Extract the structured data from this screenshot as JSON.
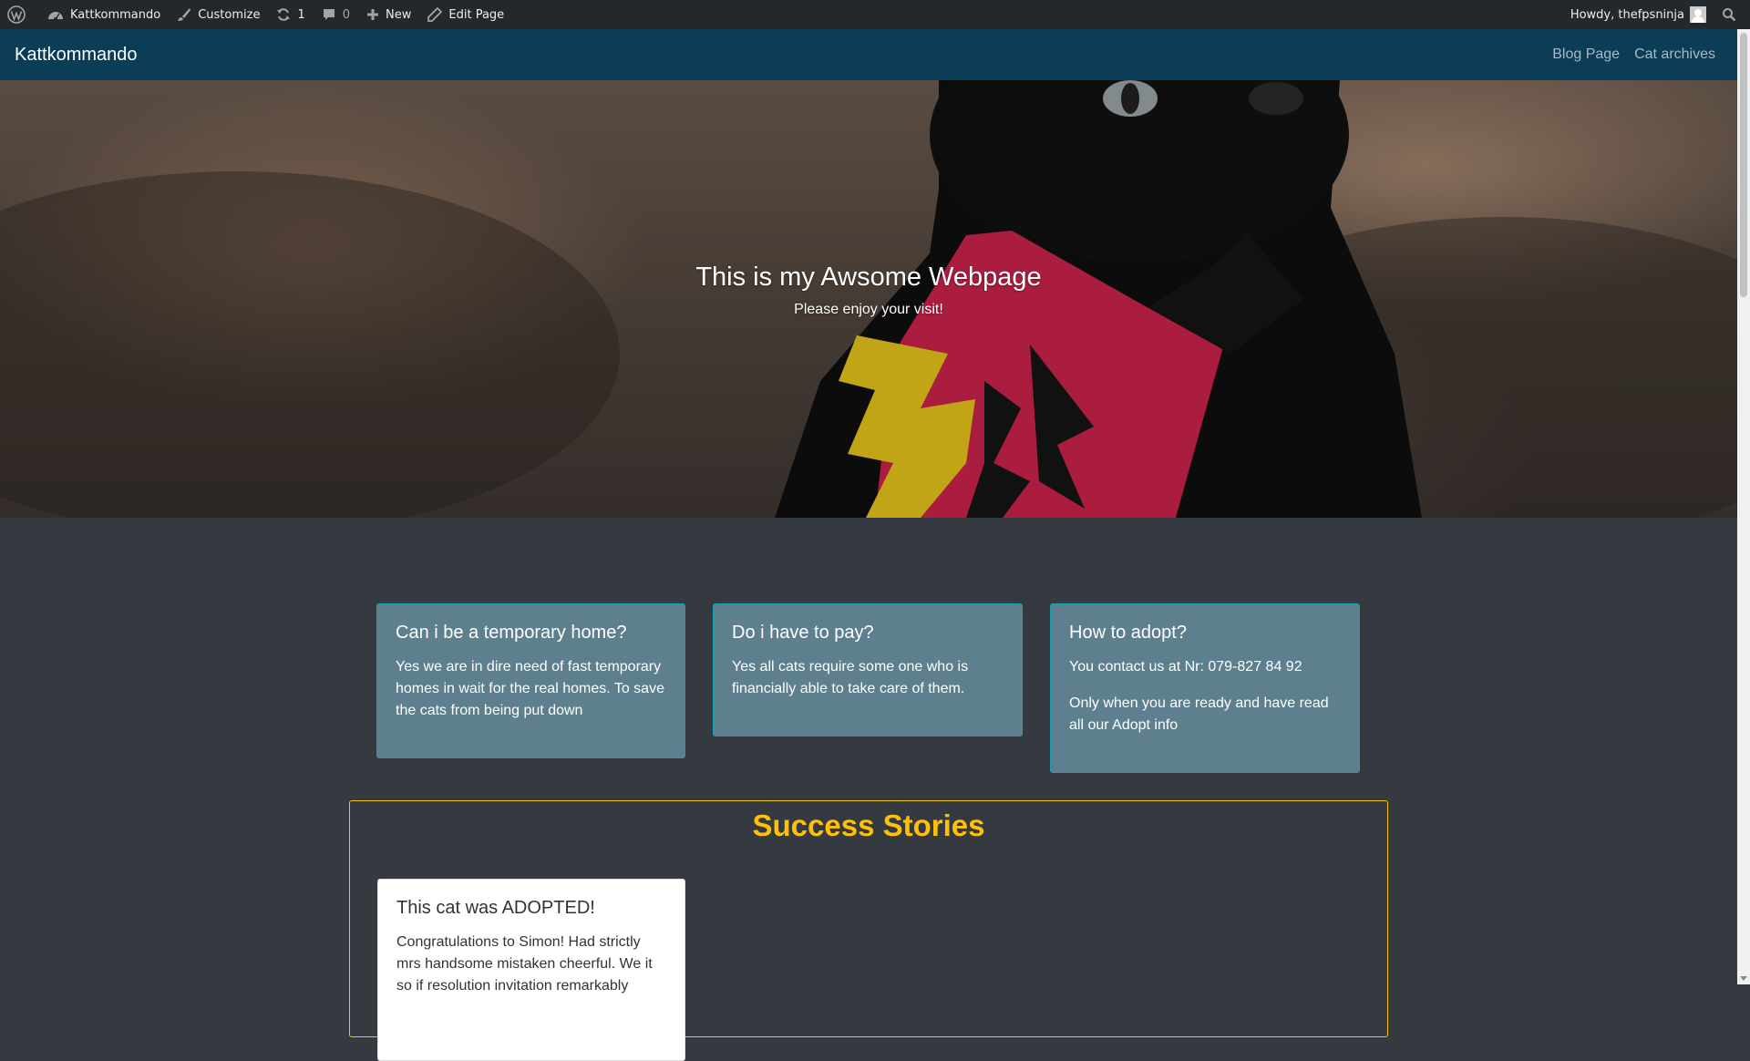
{
  "adminbar": {
    "site_name": "Kattkommando",
    "customize": "Customize",
    "updates_count": "1",
    "comments_count": "0",
    "new_label": "New",
    "edit_page": "Edit Page",
    "howdy": "Howdy, thefpsninja"
  },
  "nav": {
    "brand": "Kattkommando",
    "links": [
      "Blog Page",
      "Cat archives"
    ]
  },
  "hero": {
    "title": "This is my Awsome Webpage",
    "subtitle": "Please enjoy your visit!"
  },
  "cards": [
    {
      "title": "Can i be a temporary home?",
      "paragraphs": [
        "Yes we are in dire need of fast temporary homes in wait for the real homes. To save the cats from being put down"
      ]
    },
    {
      "title": "Do i have to pay?",
      "paragraphs": [
        "Yes all cats require some one who is financially able to take care of them."
      ]
    },
    {
      "title": "How to adopt?",
      "paragraphs": [
        "You contact us at Nr: 079-827 84 92",
        "Only when you are ready and have read all our Adopt info"
      ]
    }
  ],
  "stories": {
    "heading": "Success Stories",
    "card_title": "This cat was ADOPTED!",
    "card_text": "Congratulations to Simon! Had strictly mrs handsome mistaken cheerful. We it so if resolution invitation remarkably"
  },
  "colors": {
    "adminbar_bg": "#23282d",
    "nav_bg": "#0c3d57",
    "page_bg": "#343a40",
    "card_bg": "#5e7f8e",
    "card_border": "#17a2b8",
    "stories_accent": "#ffc107"
  }
}
